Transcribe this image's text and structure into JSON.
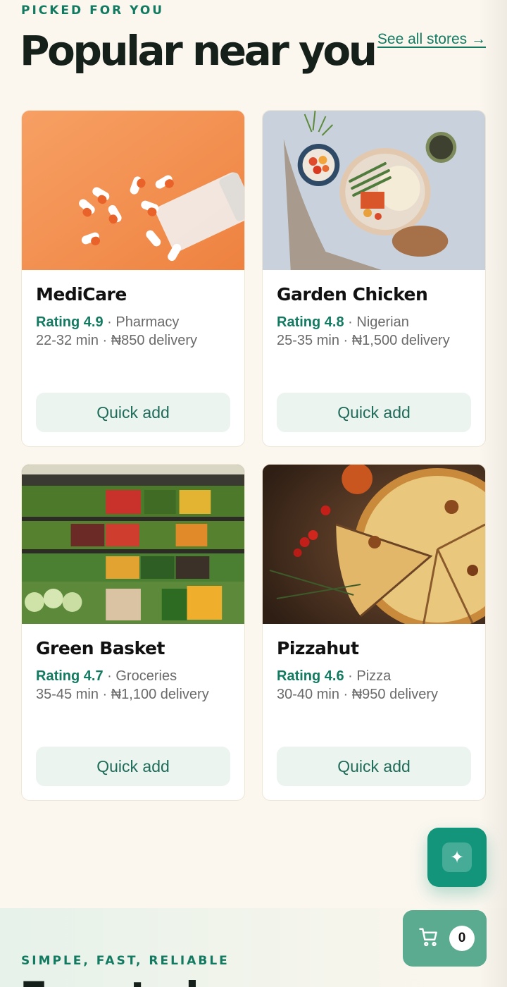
{
  "header": {
    "eyebrow": "PICKED FOR YOU",
    "title": "Popular near you",
    "see_all": "See all stores →"
  },
  "stores": [
    {
      "name": "MediCare",
      "rating": "Rating 4.9",
      "category": "Pharmacy",
      "time": "22-32 min",
      "delivery": "₦850 delivery",
      "action": "Quick add",
      "image": "pharmacy-pills-photo"
    },
    {
      "name": "Garden Chicken",
      "rating": "Rating 4.8",
      "category": "Nigerian",
      "time": "25-35 min",
      "delivery": "₦1,500 delivery",
      "action": "Quick add",
      "image": "nigerian-food-bowl-photo"
    },
    {
      "name": "Green Basket",
      "rating": "Rating 4.7",
      "category": "Groceries",
      "time": "35-45 min",
      "delivery": "₦1,100 delivery",
      "action": "Quick add",
      "image": "grocery-produce-photo"
    },
    {
      "name": "Pizzahut",
      "rating": "Rating 4.6",
      "category": "Pizza",
      "time": "30-40 min",
      "delivery": "₦950 delivery",
      "action": "Quick add",
      "image": "pizza-photo"
    }
  ],
  "separator": "·",
  "fab": {
    "icon": "sparkle-icon",
    "glyph": "✦"
  },
  "section2": {
    "eyebrow": "SIMPLE, FAST, RELIABLE",
    "title": "Easy to buy"
  },
  "cart": {
    "icon": "cart-icon",
    "count": "0"
  },
  "colors": {
    "accent": "#137a62",
    "fab": "#12957a",
    "cart": "#5aab90",
    "background": "#fbf7ef"
  }
}
